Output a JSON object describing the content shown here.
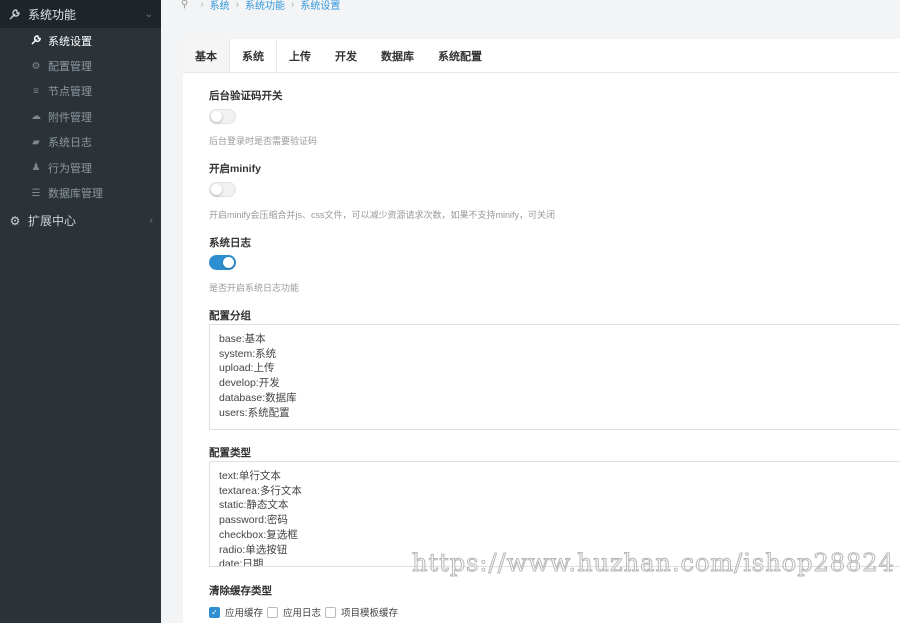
{
  "sidebar": {
    "group_system": {
      "label": "系统功能",
      "icon": "wrench-icon"
    },
    "items": [
      {
        "label": "系统设置",
        "icon": "wrench-icon",
        "active": true
      },
      {
        "label": "配置管理",
        "icon": "gears-icon"
      },
      {
        "label": "节点管理",
        "icon": "list-icon"
      },
      {
        "label": "附件管理",
        "icon": "cloud-upload-icon"
      },
      {
        "label": "系统日志",
        "icon": "book-icon"
      },
      {
        "label": "行为管理",
        "icon": "user-icon"
      },
      {
        "label": "数据库管理",
        "icon": "database-icon"
      }
    ],
    "group_ext": {
      "label": "扩展中心",
      "icon": "cogs-icon"
    }
  },
  "breadcrumb": [
    "系统",
    "系统功能",
    "系统设置"
  ],
  "tabs": [
    "基本",
    "系统",
    "上传",
    "开发",
    "数据库",
    "系统配置"
  ],
  "active_tab": "系统",
  "fields": {
    "captcha": {
      "label": "后台验证码开关",
      "help": "后台登录时是否需要验证码",
      "on": false
    },
    "minify": {
      "label": "开启minify",
      "help": "开启minify会压缩合并js、css文件，可以减少资源请求次数，如果不支持minify，可关闭",
      "on": false
    },
    "syslog": {
      "label": "系统日志",
      "help": "是否开启系统日志功能",
      "on": true
    },
    "config_group": {
      "label": "配置分组",
      "lines": [
        "base:基本",
        "system:系统",
        "upload:上传",
        "develop:开发",
        "database:数据库",
        "users:系统配置"
      ]
    },
    "config_type": {
      "label": "配置类型",
      "lines": [
        "text:单行文本",
        "textarea:多行文本",
        "static:静态文本",
        "password:密码",
        "checkbox:复选框",
        "radio:单选按钮",
        "date:日期"
      ]
    },
    "clear_cache": {
      "label": "清除缓存类型",
      "options": [
        {
          "label": "应用缓存",
          "checked": true
        },
        {
          "label": "应用日志",
          "checked": false
        },
        {
          "label": "项目模板缓存",
          "checked": false
        }
      ]
    }
  },
  "watermark": "https://www.huzhan.com/ishop28824",
  "colors": {
    "primary": "#2d8fd0",
    "sidebar": "#2c3338"
  }
}
